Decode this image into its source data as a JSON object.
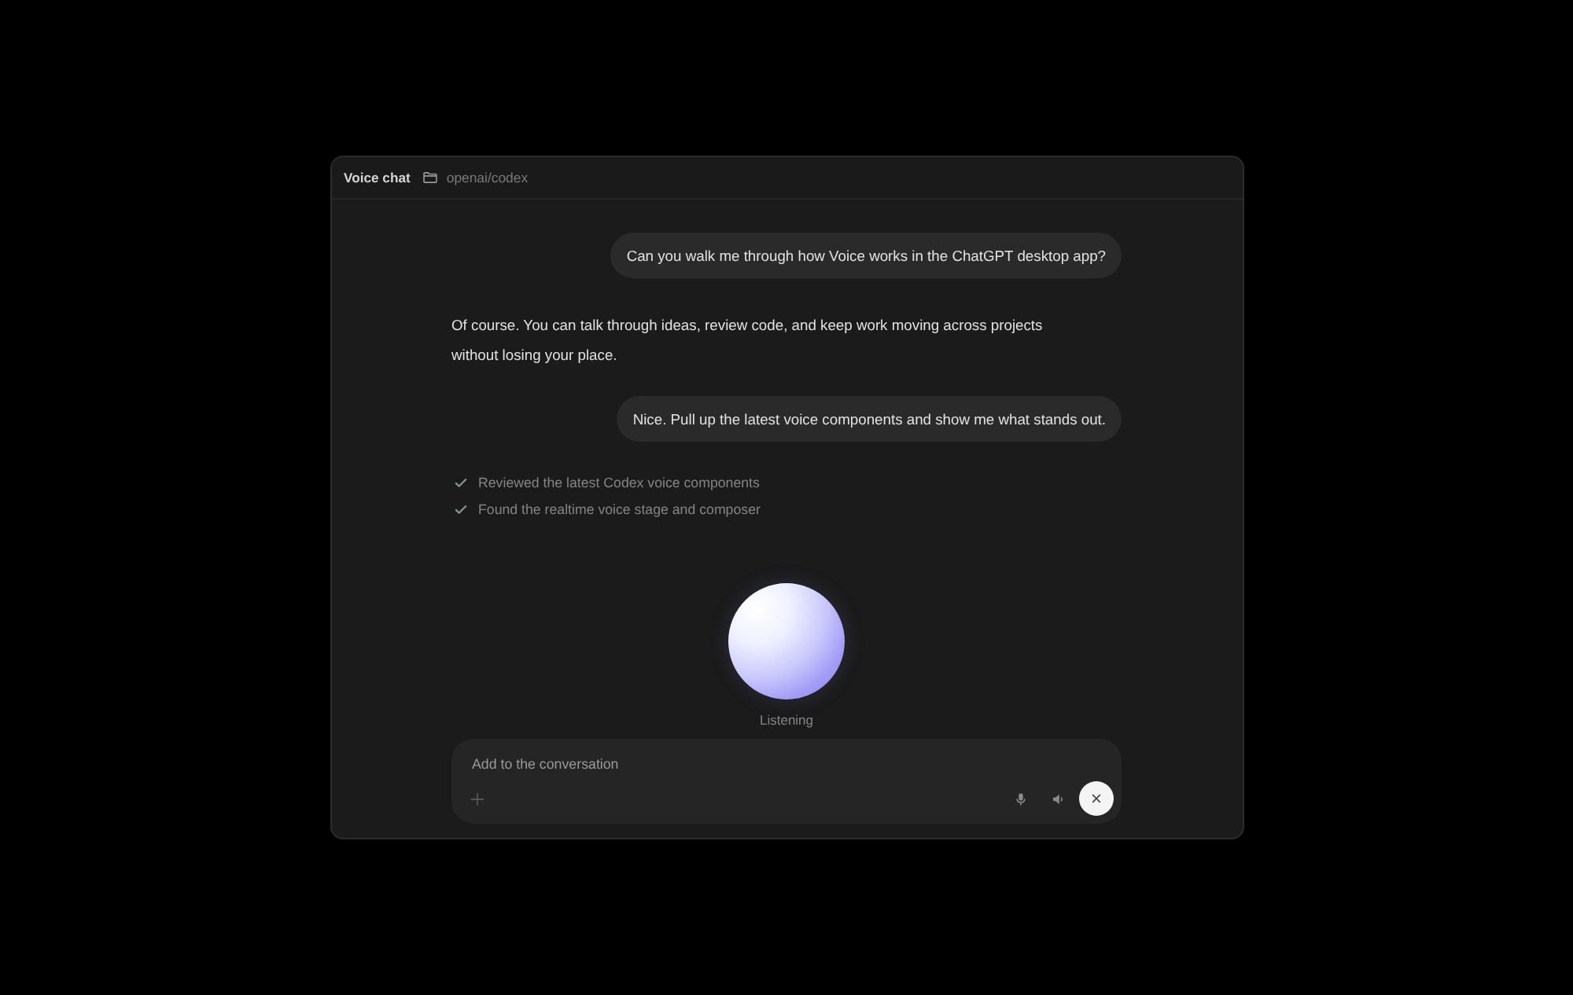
{
  "window": {
    "title": "Voice chat",
    "project": "openai/codex"
  },
  "messages": [
    {
      "kind": "user",
      "text": "Can you walk me through how Voice works in the ChatGPT desktop app?"
    },
    {
      "kind": "assistant",
      "text": "Of course. You can talk through ideas, review code, and keep work moving across projects without losing your place."
    },
    {
      "kind": "user",
      "text": "Nice. Pull up the latest voice components and show me what stands out."
    }
  ],
  "activity": [
    {
      "text": "Reviewed the latest Codex voice components",
      "done": true
    },
    {
      "text": "Found the realtime voice stage and composer",
      "done": true
    }
  ],
  "voice": {
    "status": "Listening"
  },
  "composer": {
    "placeholder": "Add to the conversation"
  }
}
